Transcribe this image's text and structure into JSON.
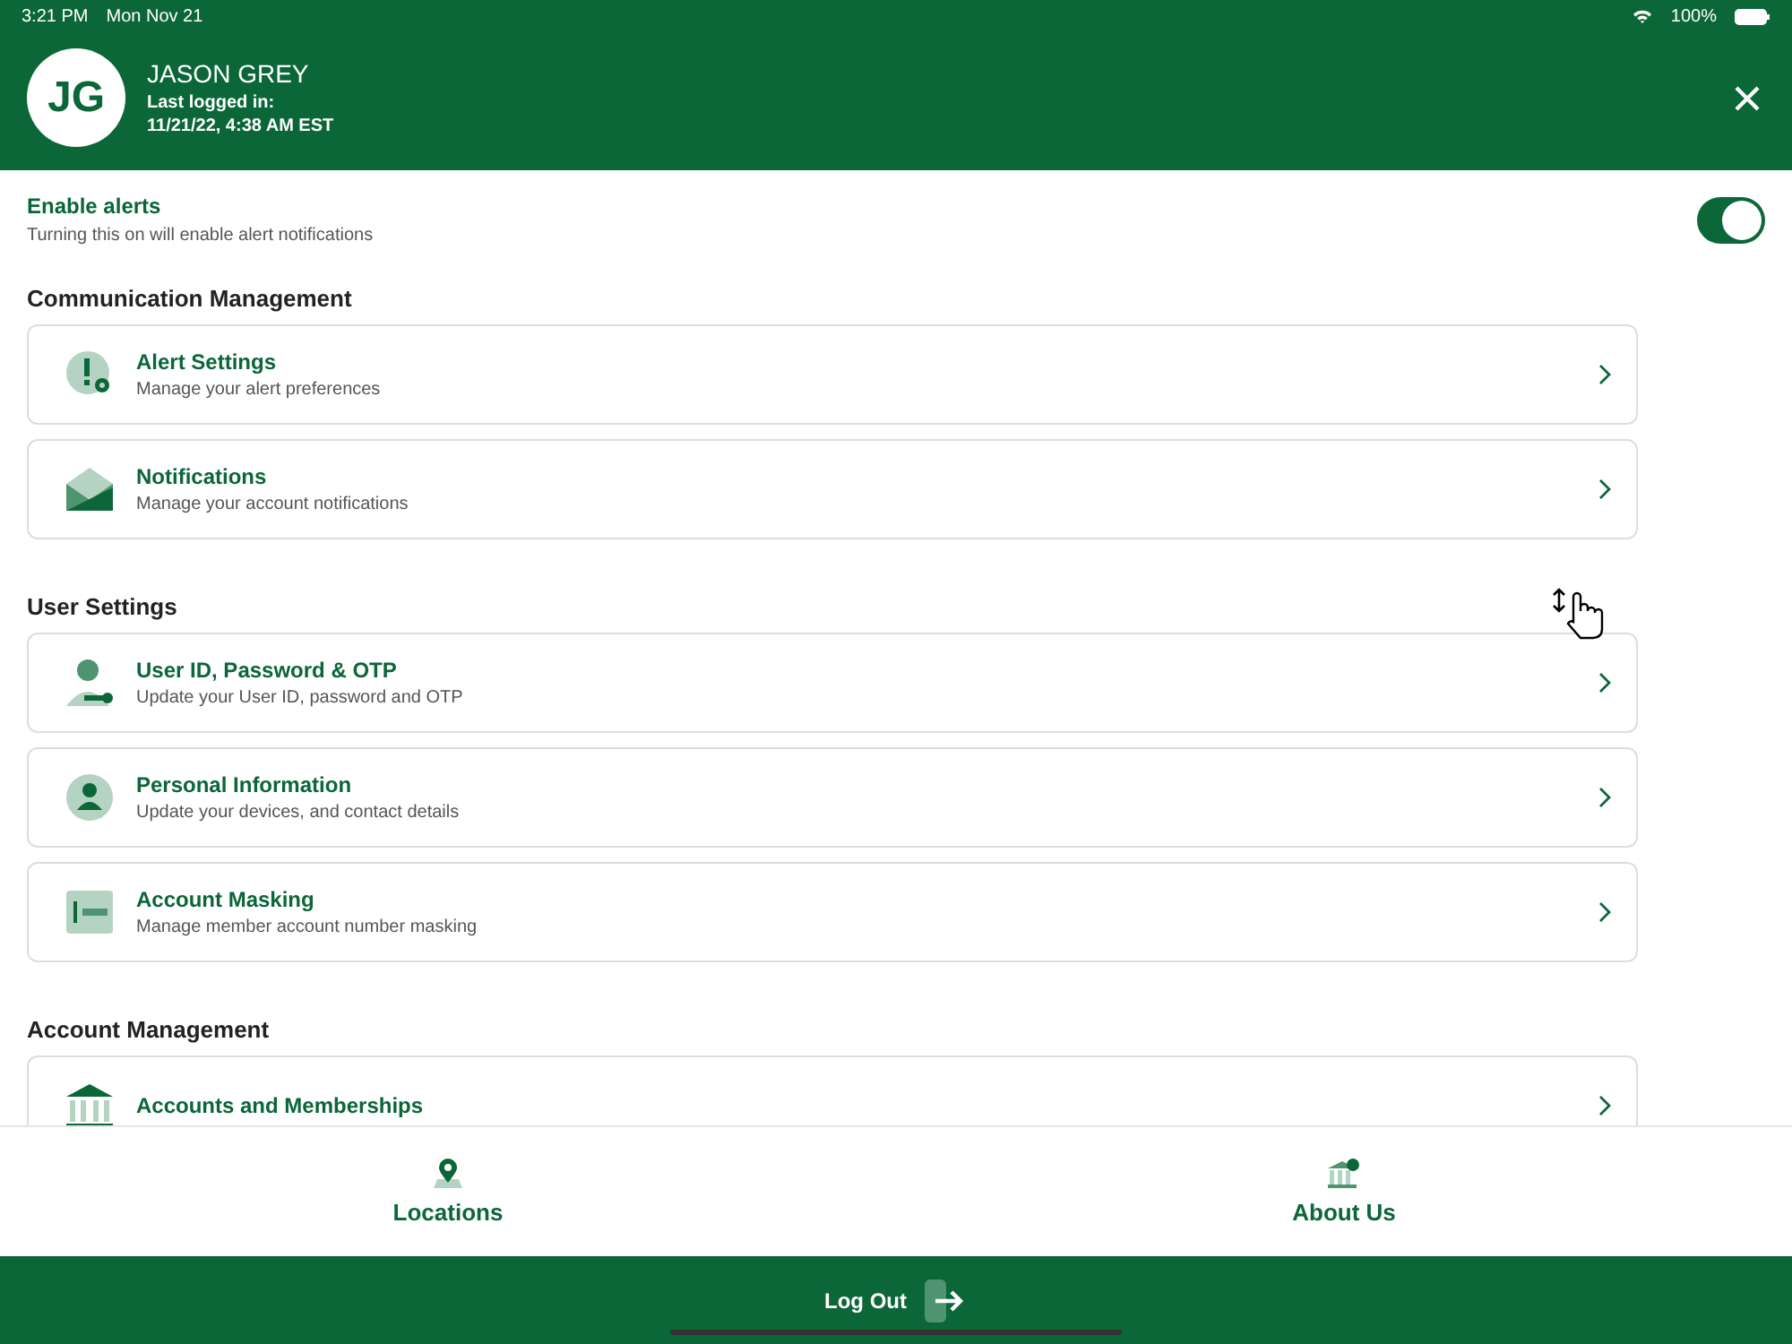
{
  "status_bar": {
    "time": "3:21 PM",
    "date": "Mon Nov 21",
    "battery": "100%"
  },
  "profile": {
    "initials": "JG",
    "name": "JASON GREY",
    "last_login_label": "Last logged in:",
    "last_login": "11/21/22, 4:38 AM EST"
  },
  "alerts_toggle": {
    "title": "Enable alerts",
    "description": "Turning this on will enable alert notifications",
    "on": true
  },
  "sections": [
    {
      "title": "Communication Management",
      "items": [
        {
          "kind": "alert",
          "title": "Alert Settings",
          "subtitle": "Manage your alert preferences"
        },
        {
          "kind": "mail",
          "title": "Notifications",
          "subtitle": "Manage your account notifications"
        }
      ]
    },
    {
      "title": "User Settings",
      "items": [
        {
          "kind": "key",
          "title": "User ID, Password & OTP",
          "subtitle": "Update your User ID, password and OTP"
        },
        {
          "kind": "person",
          "title": "Personal Information",
          "subtitle": "Update your devices, and contact details"
        },
        {
          "kind": "mask",
          "title": "Account Masking",
          "subtitle": "Manage member account number masking"
        }
      ]
    },
    {
      "title": "Account Management",
      "items": [
        {
          "kind": "bank",
          "title": "Accounts and Memberships"
        }
      ]
    }
  ],
  "bottom_nav": [
    {
      "kind": "pin",
      "label": "Locations"
    },
    {
      "kind": "bank",
      "label": "About Us"
    }
  ],
  "logout": {
    "label": "Log Out"
  }
}
